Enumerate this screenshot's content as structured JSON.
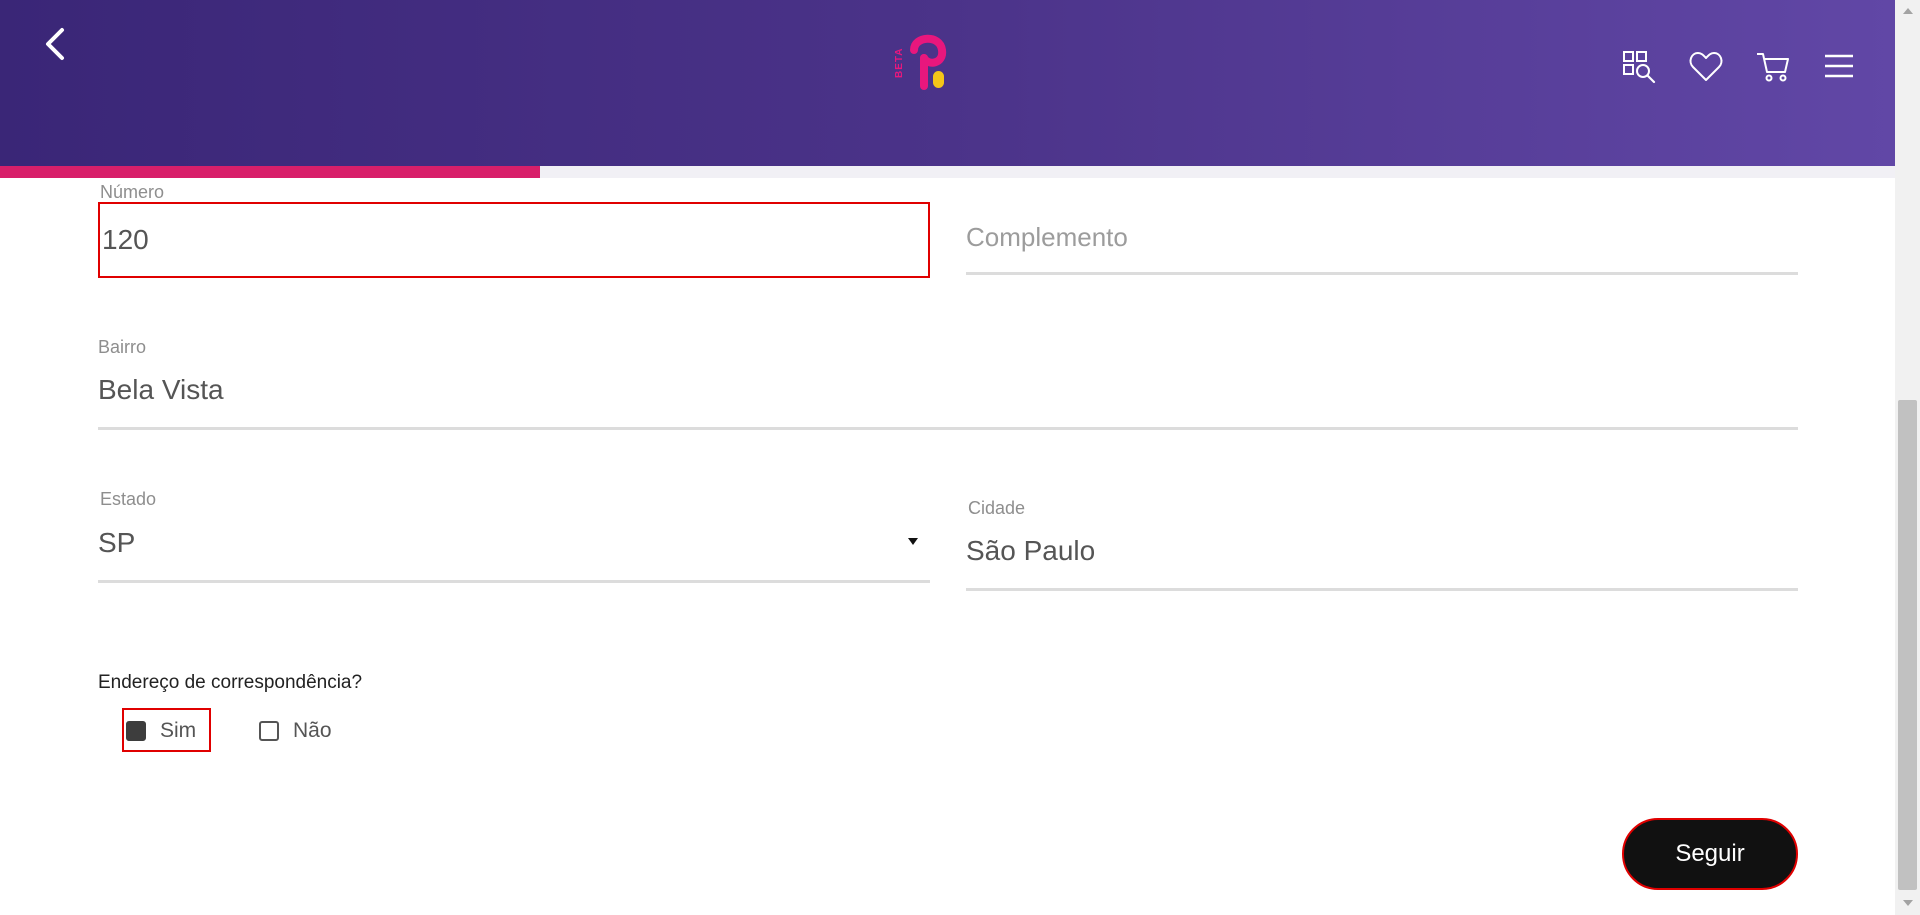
{
  "header": {
    "logo_badge": "BETA",
    "icons": [
      "back-icon",
      "search-category-icon",
      "heart-icon",
      "cart-icon",
      "menu-icon"
    ],
    "colors": {
      "gradient_start": "#3a2677",
      "gradient_end": "#6147a6",
      "logo_pink": "#e8177d",
      "logo_yellow": "#f5c518"
    }
  },
  "progress": {
    "fraction": 0.285,
    "color": "#d81f6a"
  },
  "form": {
    "numero": {
      "label": "Número",
      "value": "120"
    },
    "complemento": {
      "placeholder": "Complemento"
    },
    "bairro": {
      "label": "Bairro",
      "value": "Bela Vista"
    },
    "estado": {
      "label": "Estado",
      "value": "SP"
    },
    "cidade": {
      "label": "Cidade",
      "value": "São Paulo"
    },
    "correspondencia": {
      "question": "Endereço de correspondência?",
      "options": [
        {
          "label": "Sim",
          "checked": true
        },
        {
          "label": "Não",
          "checked": false
        }
      ]
    },
    "submit_label": "Seguir"
  }
}
